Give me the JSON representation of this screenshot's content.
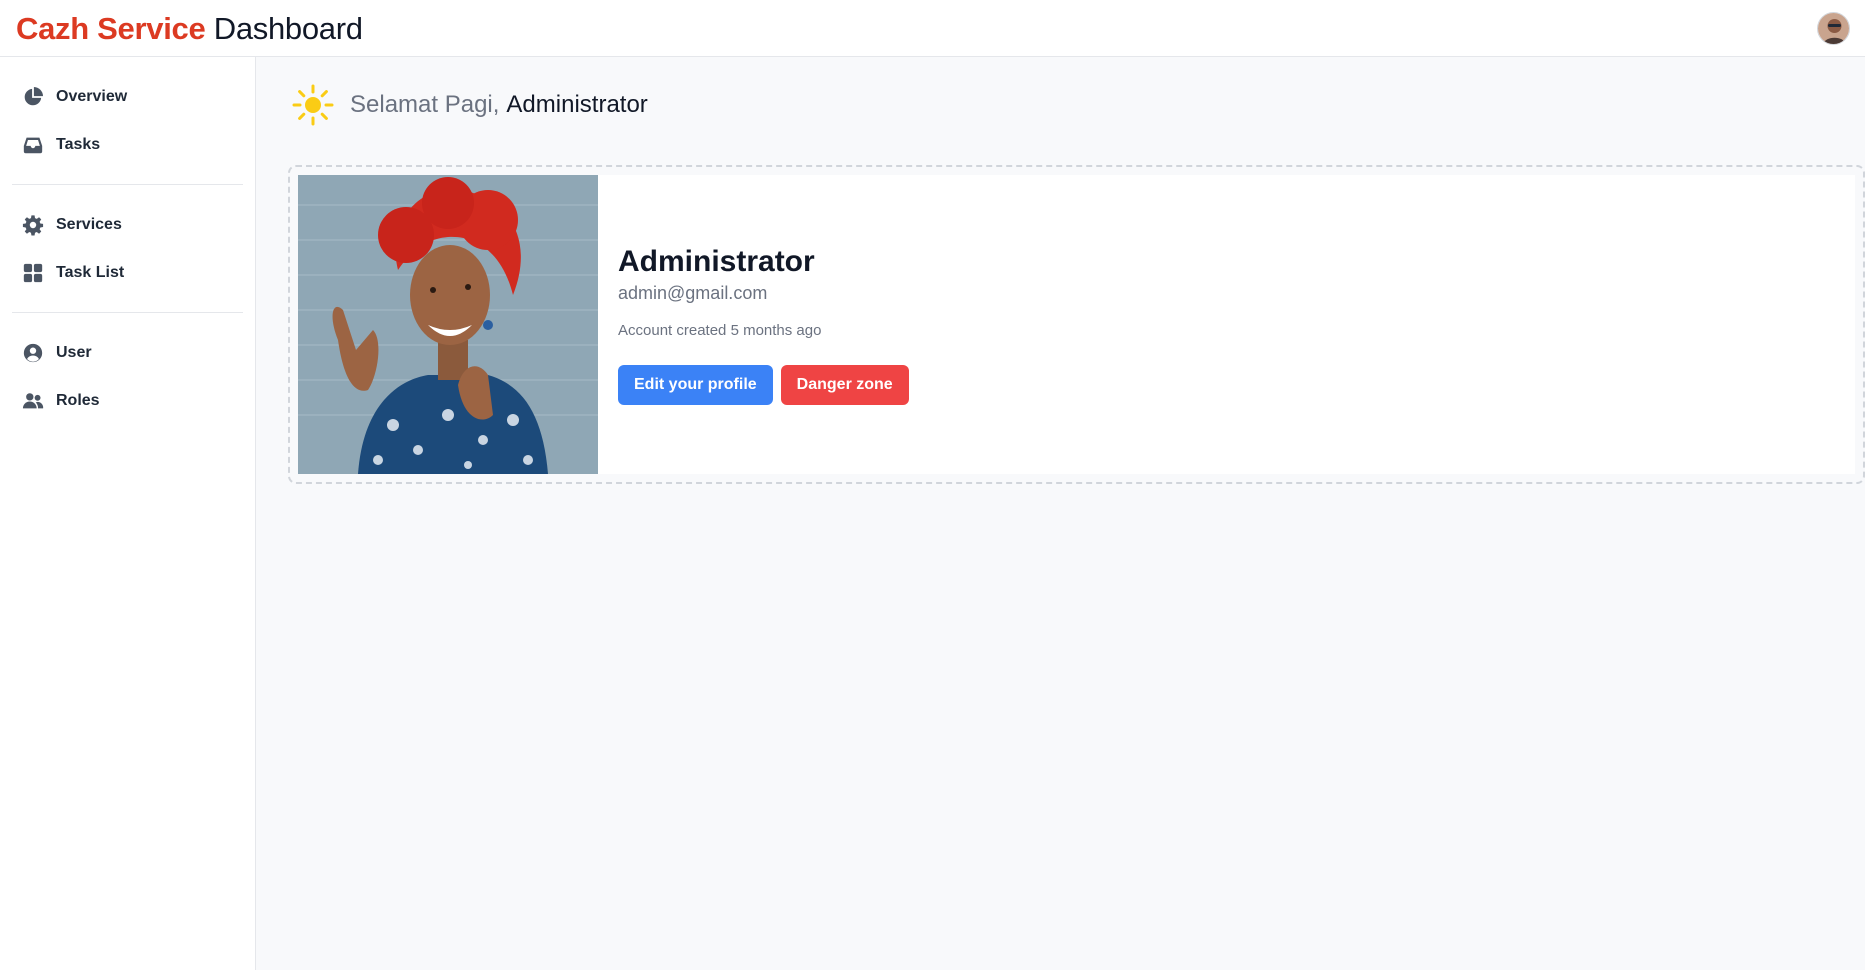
{
  "header": {
    "brand_primary": "Cazh Service",
    "brand_secondary": "Dashboard",
    "avatar_icon": "user-avatar"
  },
  "sidebar": {
    "items": [
      {
        "label": "Overview",
        "icon": "pie-chart-icon"
      },
      {
        "label": "Tasks",
        "icon": "inbox-icon"
      },
      {
        "label": "Services",
        "icon": "gear-icon"
      },
      {
        "label": "Task List",
        "icon": "grid-icon"
      },
      {
        "label": "User",
        "icon": "user-circle-icon"
      },
      {
        "label": "Roles",
        "icon": "users-icon"
      }
    ]
  },
  "greeting": {
    "icon": "sun-icon",
    "salutation": "Selamat Pagi,",
    "name": "Administrator"
  },
  "profile": {
    "name": "Administrator",
    "email": "admin@gmail.com",
    "created": "Account created 5 months ago",
    "edit_label": "Edit your profile",
    "danger_label": "Danger zone"
  },
  "colors": {
    "brand": "#dc3a22",
    "primary_button": "#3b82f6",
    "danger_button": "#ef4444",
    "sun": "#facc15"
  }
}
